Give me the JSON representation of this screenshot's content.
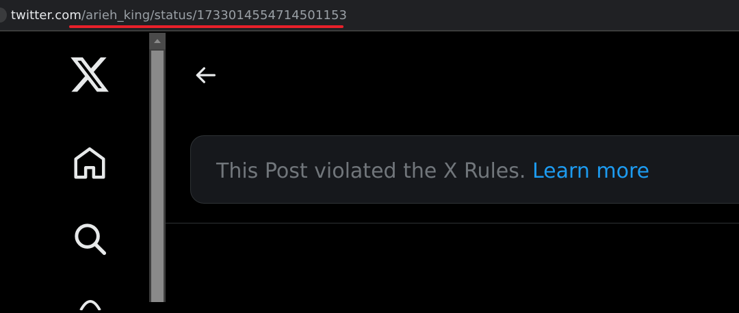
{
  "browser": {
    "url_host": "twitter.com",
    "url_path": "/arieh_king/status/1733014554714501153",
    "annotation_color": "#e8202a"
  },
  "nav": {
    "items": [
      {
        "icon": "x-logo-icon"
      },
      {
        "icon": "home-icon"
      },
      {
        "icon": "search-icon"
      }
    ]
  },
  "header": {
    "back_icon": "back-arrow-icon"
  },
  "notice": {
    "message": "This Post violated the X Rules.",
    "link_text": "Learn more",
    "link_color": "#1d9bf0"
  }
}
